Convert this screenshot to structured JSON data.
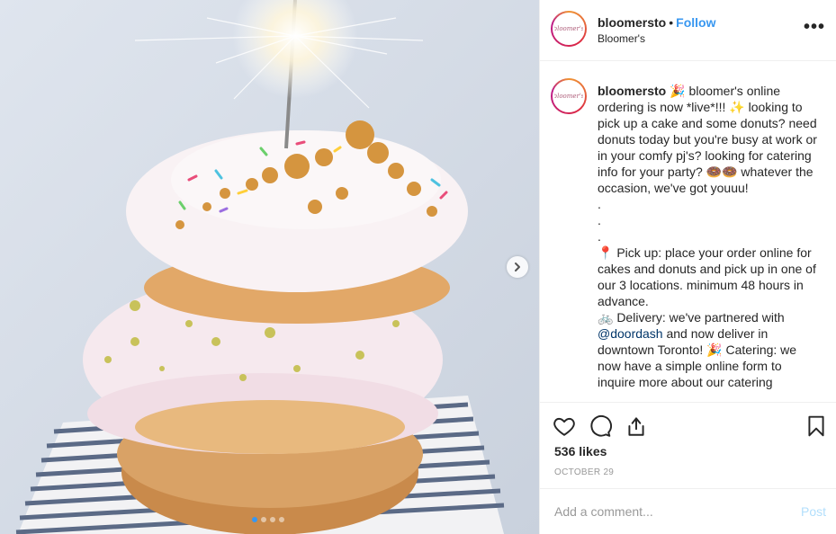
{
  "post": {
    "username": "bloomersto",
    "follow_label": "Follow",
    "separator": "•",
    "location": "Bloomer's",
    "more_glyph": "•••",
    "avatar_text": "bloomer's",
    "caption_lines": [
      "🎉 bloomer's online ordering is now *live*!!! ✨ looking to pick up a cake and some donuts? need donuts today but you're busy at work or in your comfy pj's? looking for catering info for your party? 🍩🍩 whatever the occasion, we've got youuu!",
      ".",
      ".",
      ".",
      "📍 Pick up: place your order online for cakes and donuts and pick up in one of our 3 locations. minimum 48 hours in advance."
    ],
    "delivery_prefix": "🚲 Delivery: we've partnered with ",
    "delivery_mention": "@doordash",
    "delivery_suffix": " and now deliver in downtown Toronto! 🎉 Catering: we now have a simple online form to inquire more about our catering",
    "likes": "536 likes",
    "date": "OCTOBER 29",
    "comment_placeholder": "Add a comment...",
    "post_label": "Post"
  },
  "icons": [
    "heart-icon",
    "comment-icon",
    "share-icon",
    "bookmark-icon",
    "chevron-right-icon"
  ],
  "colors": {
    "link": "#3897f0",
    "mention": "#003569",
    "post_disabled": "#b2dffc"
  }
}
